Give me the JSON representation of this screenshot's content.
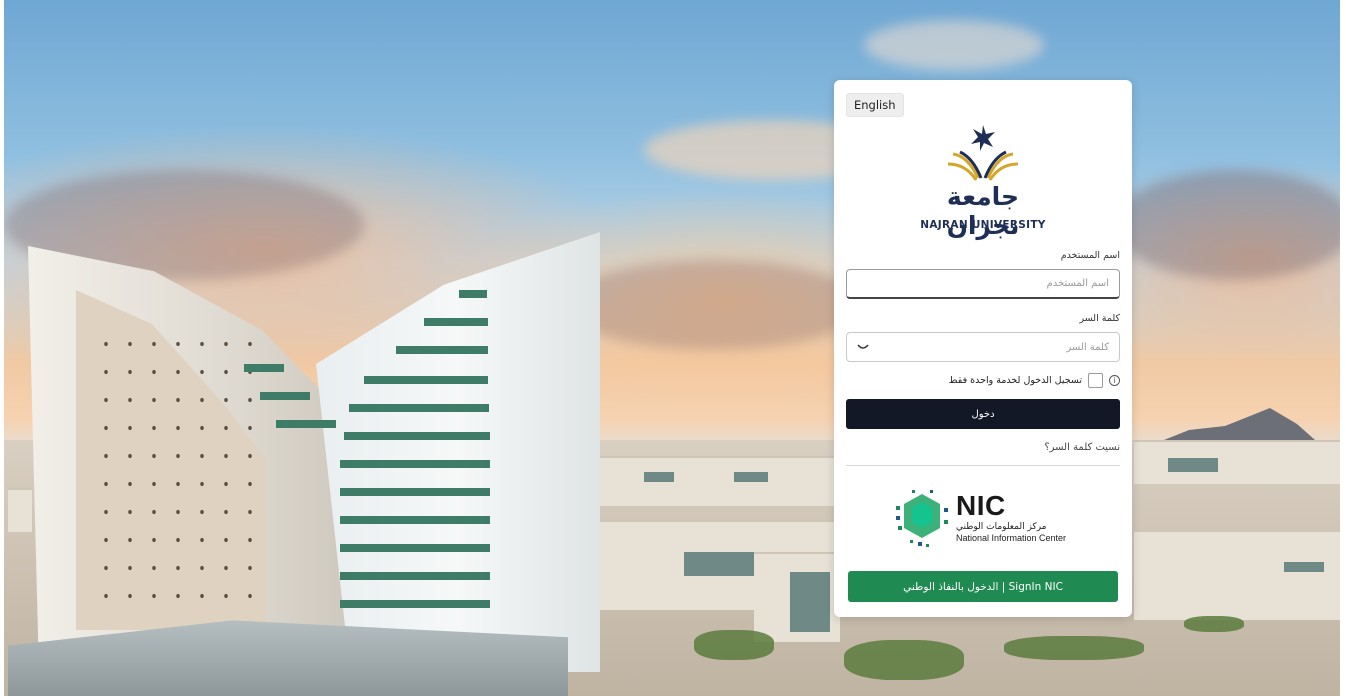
{
  "login": {
    "language_button": "English",
    "university_name_ar": "جامعة نجران",
    "university_name_en": "NAJRAN UNIVERSITY",
    "username_label": "اسم المستخدم",
    "username_placeholder": "اسم المستخدم",
    "username_value": "",
    "password_label": "كلمة السر",
    "password_placeholder": "كلمة السر",
    "password_value": "",
    "single_service_login_label": "تسجيل الدخول لخدمة واحدة فقط",
    "submit_button": "دخول",
    "forgot_password_link": "نسيت كلمة السر؟",
    "nic": {
      "title": "NIC",
      "name_ar": "مركز المعلومات الوطني",
      "name_en": "National Information Center",
      "signin_button": "SignIn NIC | الدخول بالنفاذ الوطني"
    }
  },
  "colors": {
    "primary_button": "#121826",
    "nic_button": "#1f8a52",
    "logo_navy": "#1e2e55",
    "logo_gold": "#d4a62a"
  },
  "icons": [
    "university-logo-icon",
    "eye-toggle-icon",
    "info-icon",
    "nic-logo-icon"
  ]
}
